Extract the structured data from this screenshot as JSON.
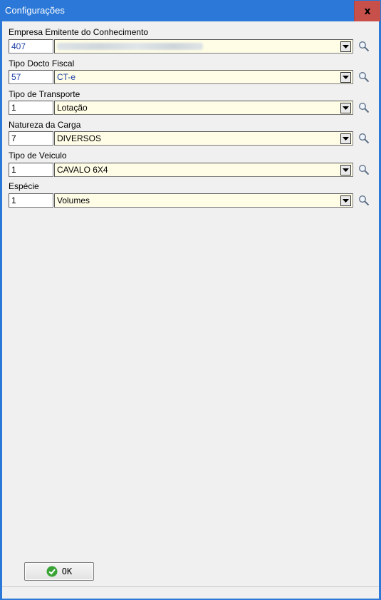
{
  "window": {
    "title": "Configurações",
    "close_label": "x"
  },
  "fields": [
    {
      "label": "Empresa Emitente do Conhecimento",
      "code": "407",
      "description": "",
      "blurred": true
    },
    {
      "label": "Tipo Docto Fiscal",
      "code": "57",
      "description": "CT-e"
    },
    {
      "label": "Tipo de Transporte",
      "code": "1",
      "description": "Lotação"
    },
    {
      "label": "Natureza da Carga",
      "code": "7",
      "description": "DIVERSOS"
    },
    {
      "label": "Tipo de Veiculo",
      "code": "1",
      "description": "CAVALO 6X4"
    },
    {
      "label": "Espécie",
      "code": "1",
      "description": "Volumes"
    }
  ],
  "buttons": {
    "ok_label": "OK"
  },
  "icons": {
    "search": "search-icon",
    "dropdown": "chevron-down-icon",
    "ok": "check-circle-icon"
  },
  "colors": {
    "title_bar": "#2b78d8",
    "close": "#c7504a",
    "desc_bg": "#fffde6",
    "ok_icon": "#3aa336"
  }
}
